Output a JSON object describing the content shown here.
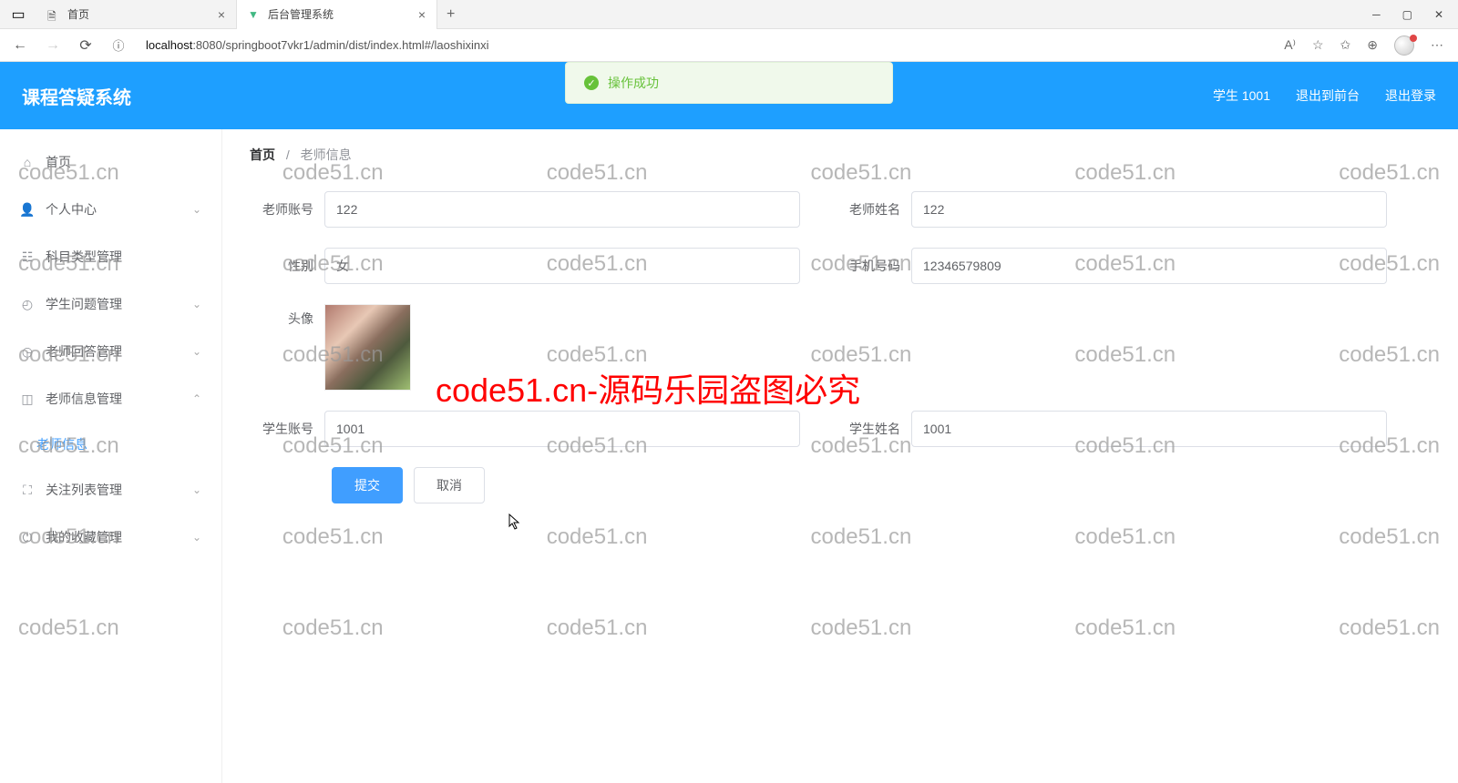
{
  "browser": {
    "tabs": [
      {
        "title": "首页",
        "active": false
      },
      {
        "title": "后台管理系统",
        "active": true
      }
    ],
    "url_host": "localhost",
    "url_port": ":8080",
    "url_path": "/springboot7vkr1/admin/dist/index.html#/laoshixinxi"
  },
  "header": {
    "app_title": "课程答疑系统",
    "user_label": "学生 1001",
    "exit_front": "退出到前台",
    "logout": "退出登录"
  },
  "toast": {
    "message": "操作成功"
  },
  "sidebar": {
    "items": [
      {
        "label": "首页",
        "icon": "home"
      },
      {
        "label": "个人中心",
        "icon": "user",
        "expandable": true
      },
      {
        "label": "科目类型管理",
        "icon": "category"
      },
      {
        "label": "学生问题管理",
        "icon": "question",
        "expandable": true
      },
      {
        "label": "老师回答管理",
        "icon": "answer",
        "expandable": true
      },
      {
        "label": "老师信息管理",
        "icon": "crop",
        "expanded": true
      },
      {
        "label": "关注列表管理",
        "icon": "watch",
        "expandable": true
      },
      {
        "label": "我的收藏管理",
        "icon": "power",
        "expandable": true
      }
    ],
    "subitem": "老师信息"
  },
  "breadcrumb": {
    "home": "首页",
    "current": "老师信息"
  },
  "form": {
    "teacher_account_label": "老师账号",
    "teacher_account": "122",
    "teacher_name_label": "老师姓名",
    "teacher_name": "122",
    "gender_label": "性别",
    "gender": "女",
    "phone_label": "手机号码",
    "phone": "12346579809",
    "avatar_label": "头像",
    "student_account_label": "学生账号",
    "student_account": "1001",
    "student_name_label": "学生姓名",
    "student_name": "1001",
    "submit": "提交",
    "cancel": "取消"
  },
  "watermark": {
    "small": "code51.cn",
    "big": "code51.cn-源码乐园盗图必究"
  }
}
